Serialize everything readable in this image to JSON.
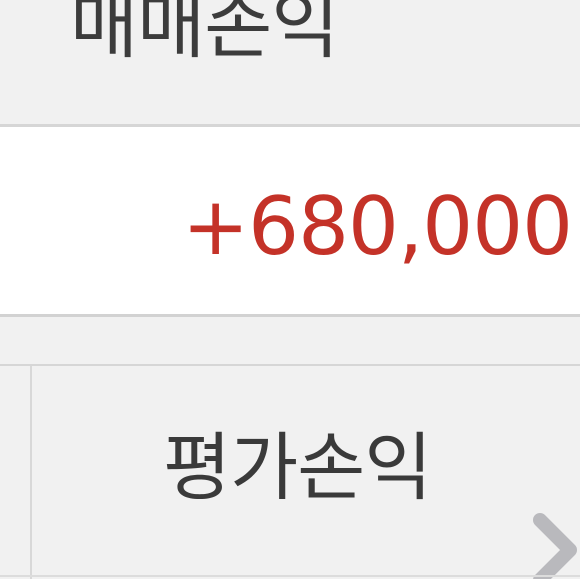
{
  "header": {
    "label": "매매손익"
  },
  "value_row": {
    "amount": "+680,000",
    "amount_color": "#c43228"
  },
  "tab": {
    "label": "평가손익"
  },
  "icons": {
    "next": "chevron-right-icon"
  },
  "colors": {
    "background": "#f1f1f1",
    "value_background": "#ffffff",
    "text": "#3c3c3c",
    "divider": "#d6d6d6",
    "chevron": "#b9b9bd"
  }
}
